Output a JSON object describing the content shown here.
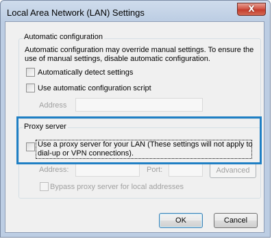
{
  "window": {
    "title": "Local Area Network (LAN) Settings",
    "close_glyph": "X"
  },
  "automatic": {
    "group_label": "Automatic configuration",
    "description_line1": "Automatic configuration may override manual settings.  To ensure the",
    "description_line2": "use of manual settings, disable automatic configuration.",
    "detect_label": "Automatically detect settings",
    "script_label": "Use automatic configuration script",
    "address_label": "Address",
    "address_value": ""
  },
  "proxy": {
    "group_label": "Proxy server",
    "use_proxy_line1": "Use a proxy server for your LAN (These settings will not apply to",
    "use_proxy_line2": "dial-up or VPN connections).",
    "address_label": "Address:",
    "address_value": "",
    "port_label": "Port:",
    "port_value": "",
    "advanced_label": "Advanced",
    "bypass_label": "Bypass proxy server for local addresses"
  },
  "buttons": {
    "ok_label": "OK",
    "cancel_label": "Cancel"
  },
  "colors": {
    "highlight_border": "#1f7fc4",
    "close_button": "#c43c2c"
  },
  "icons": {
    "close": "close-icon"
  }
}
